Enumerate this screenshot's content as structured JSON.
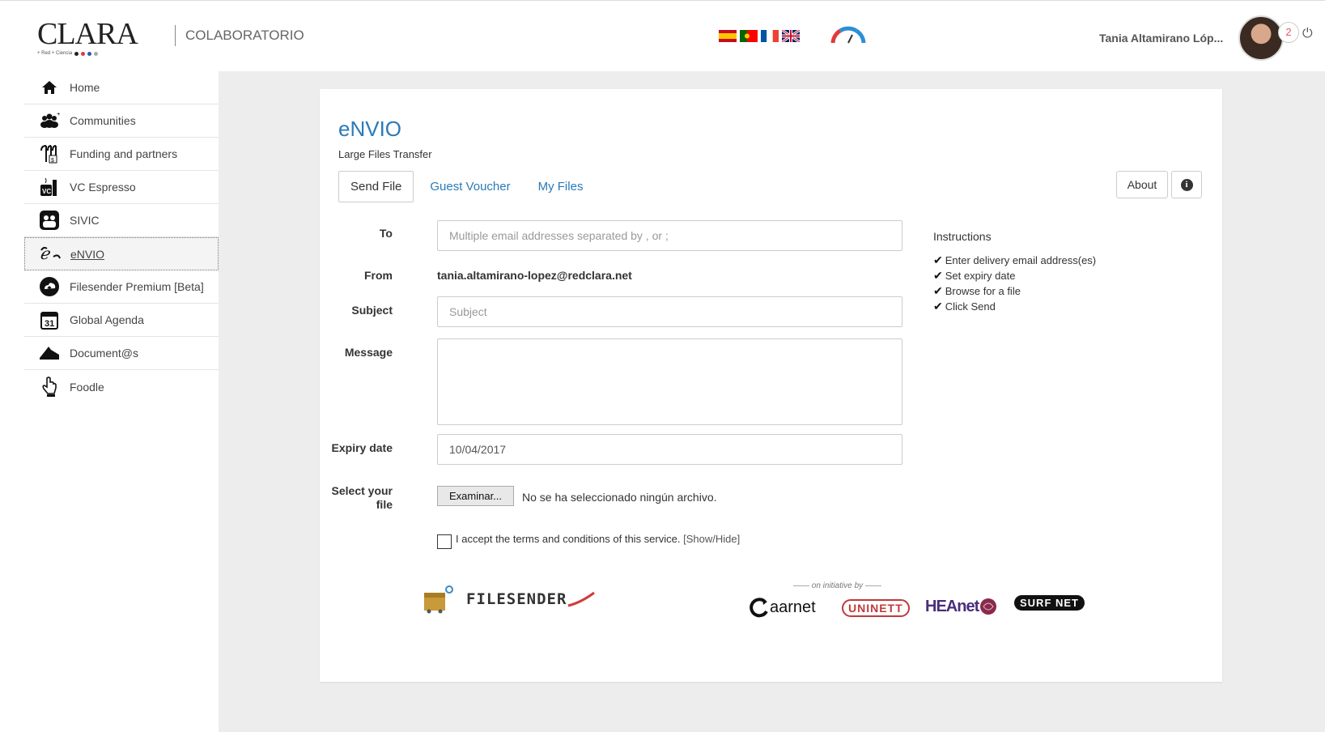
{
  "header": {
    "logo_text": "CLARA",
    "logo_sub": "+ Red  + Ciencia",
    "brand": "COLABORATORIO",
    "flags": [
      "es-flag",
      "pt-flag",
      "fr-flag",
      "uk-flag"
    ],
    "user_name": "Tania Altamirano Lóp...",
    "notification_count": "2"
  },
  "sidebar": {
    "items": [
      {
        "label": "Home",
        "icon": "home-icon"
      },
      {
        "label": "Communities",
        "icon": "users-icon"
      },
      {
        "label": "Funding and partners",
        "icon": "funding-icon"
      },
      {
        "label": "VC Espresso",
        "icon": "vc-espresso-icon"
      },
      {
        "label": "SIVIC",
        "icon": "sivic-icon"
      },
      {
        "label": "eNVIO",
        "icon": "envio-icon"
      },
      {
        "label": "Filesender Premium [Beta]",
        "icon": "filesender-icon"
      },
      {
        "label": "Global Agenda",
        "icon": "calendar-icon"
      },
      {
        "label": "Document@s",
        "icon": "documents-icon"
      },
      {
        "label": "Foodle",
        "icon": "hand-pointer-icon"
      }
    ]
  },
  "panel": {
    "title": "eNVIO",
    "subtitle": "Large Files Transfer",
    "tabs": [
      "Send File",
      "Guest Voucher",
      "My Files"
    ],
    "about_label": "About",
    "form": {
      "to_label": "To",
      "to_placeholder": "Multiple email addresses separated by , or ;",
      "from_label": "From",
      "from_value": "tania.altamirano-lopez@redclara.net",
      "subject_label": "Subject",
      "subject_placeholder": "Subject",
      "message_label": "Message",
      "expiry_label": "Expiry date",
      "expiry_value": "10/04/2017",
      "file_label_1": "Select your",
      "file_label_2": "file",
      "browse_label": "Examinar...",
      "no_file_text": "No se ha seleccionado ningún archivo.",
      "terms_text": "I accept the terms and conditions of this service.",
      "terms_toggle": "[Show/Hide]"
    },
    "instructions": {
      "title": "Instructions",
      "items": [
        "Enter delivery email address(es)",
        "Set expiry date",
        "Browse for a file",
        "Click Send"
      ]
    },
    "footer": {
      "filesender": "FILESENDER",
      "initiative": "—— on initiative by ——",
      "partners": [
        "aarnet",
        "UNINETT",
        "HEAnet",
        "SURF NET"
      ]
    }
  }
}
